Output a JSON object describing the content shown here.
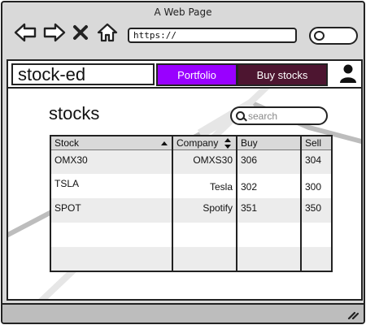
{
  "browser": {
    "title": "A Web Page",
    "url": "https://",
    "icons": [
      "back-arrow-icon",
      "forward-arrow-icon",
      "close-icon",
      "home-icon",
      "search-icon"
    ]
  },
  "app": {
    "brand": "stock-ed",
    "tabs": [
      {
        "label": "Portfolio",
        "color": "#9900ff"
      },
      {
        "label": "Buy stocks",
        "color": "#4d1530"
      }
    ],
    "user_icon": "user-icon"
  },
  "page": {
    "title": "stocks",
    "search_placeholder": "search"
  },
  "table": {
    "headers": [
      "Stock",
      "Company",
      "Buy",
      "Sell"
    ],
    "rows": [
      [
        "OMX30",
        "OMXS30",
        "306",
        "304"
      ],
      [
        "TSLA",
        "Tesla",
        "302",
        "300"
      ],
      [
        "SPOT",
        "Spotify",
        "351",
        "350"
      ],
      [
        "",
        "",
        "",
        ""
      ],
      [
        "",
        "",
        "",
        ""
      ]
    ]
  },
  "status_bar": {
    "grip_icon": "resize-grip-icon"
  }
}
